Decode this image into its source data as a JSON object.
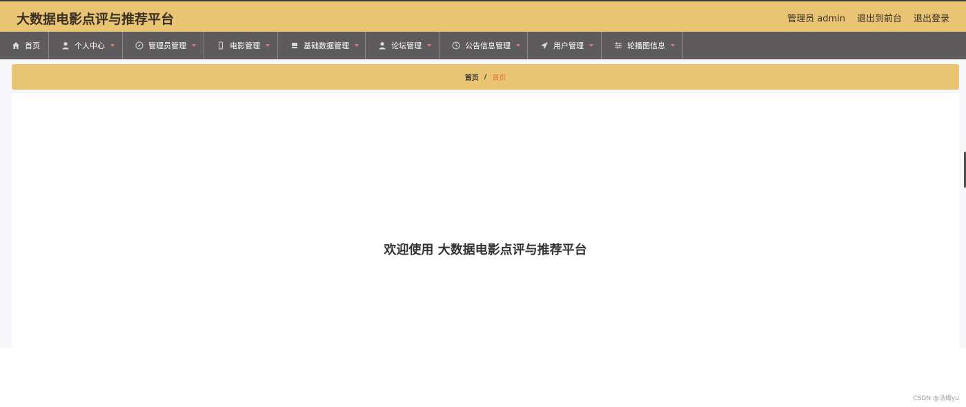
{
  "header": {
    "title": "大数据电影点评与推荐平台",
    "user_label": "管理员 admin",
    "back_to_front": "退出到前台",
    "logout": "退出登录"
  },
  "nav": [
    {
      "label": "首页",
      "icon": "home-icon",
      "has_caret": false
    },
    {
      "label": "个人中心",
      "icon": "user-icon",
      "has_caret": true
    },
    {
      "label": "管理员管理",
      "icon": "compass-icon",
      "has_caret": true
    },
    {
      "label": "电影管理",
      "icon": "phone-icon",
      "has_caret": true
    },
    {
      "label": "基础数据管理",
      "icon": "card-icon",
      "has_caret": true
    },
    {
      "label": "论坛管理",
      "icon": "user-icon",
      "has_caret": true
    },
    {
      "label": "公告信息管理",
      "icon": "clock-icon",
      "has_caret": true
    },
    {
      "label": "用户管理",
      "icon": "send-icon",
      "has_caret": true
    },
    {
      "label": "轮播图信息",
      "icon": "sliders-icon",
      "has_caret": true
    }
  ],
  "breadcrumb": {
    "home": "首页",
    "separator": "/",
    "current": "首页"
  },
  "main": {
    "welcome": "欢迎使用 大数据电影点评与推荐平台"
  },
  "watermark": "CSDN @汤姆yu",
  "colors": {
    "accent": "#e8c473",
    "nav_bg": "#5e5b5d",
    "breadcrumb_current": "#e8723a",
    "caret": "#d97979"
  }
}
